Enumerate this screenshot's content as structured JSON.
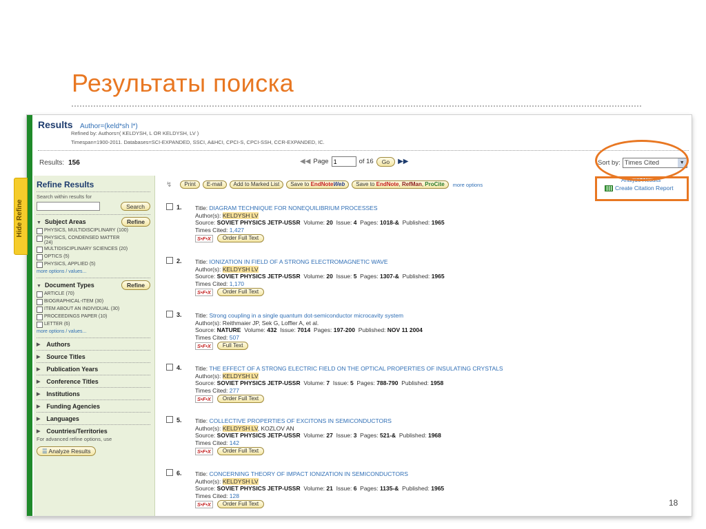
{
  "slide": {
    "title": "Результаты поиска",
    "page_number": "18"
  },
  "header": {
    "results_label": "Results",
    "query": "Author=(keld*sh l*)",
    "refined_by": "Refined by: Authors=( KELDYSH, L OR KELDYSH, LV )",
    "timespan": "Timespan=1900-2011. Databases=SCI-EXPANDED, SSCI, A&HCI, CPCI-S, CPCI-SSH, CCR-EXPANDED, IC."
  },
  "results": {
    "label": "Results:",
    "count": "156"
  },
  "pager": {
    "page_label": "Page",
    "page_value": "1",
    "of_label": "of 16",
    "go": "Go"
  },
  "sort": {
    "label": "Sort by:",
    "value": "Times Cited"
  },
  "side_links": {
    "analyze": "Analyze Results",
    "citation_report": "Create Citation Report"
  },
  "hide_refine": "Hide Refine",
  "toolbar": {
    "print": "Print",
    "email": "E-mail",
    "add_marked": "Add to Marked List",
    "save_to": "Save to",
    "endnote": "EndNote",
    "web": "Web",
    "save_to2": "Save to",
    "refman": "RefMan",
    "procite": "ProCite",
    "more_options": "more options"
  },
  "refine": {
    "title": "Refine Results",
    "search_label": "Search within results for",
    "search_button": "Search",
    "subject_areas": {
      "label": "Subject Areas",
      "button": "Refine",
      "items": [
        {
          "name": "PHYSICS, MULTIDISCIPLINARY",
          "count": "(100)"
        },
        {
          "name": "PHYSICS, CONDENSED MATTER",
          "count": "(24)"
        },
        {
          "name": "MULTIDISCIPLINARY SCIENCES",
          "count": "(20)"
        },
        {
          "name": "OPTICS",
          "count": "(5)"
        },
        {
          "name": "PHYSICS, APPLIED",
          "count": "(5)"
        }
      ],
      "more": "more options / values..."
    },
    "document_types": {
      "label": "Document Types",
      "button": "Refine",
      "items": [
        {
          "name": "ARTICLE",
          "count": "(70)"
        },
        {
          "name": "BIOGRAPHICAL-ITEM",
          "count": "(30)"
        },
        {
          "name": "ITEM ABOUT AN INDIVIDUAL",
          "count": "(30)"
        },
        {
          "name": "PROCEEDINGS PAPER",
          "count": "(10)"
        },
        {
          "name": "LETTER",
          "count": "(6)"
        }
      ],
      "more": "more options / values..."
    },
    "collapsed": [
      "Authors",
      "Source Titles",
      "Publication Years",
      "Conference Titles",
      "Institutions",
      "Funding Agencies",
      "Languages",
      "Countries/Territories"
    ],
    "advanced_note": "For advanced refine options, use",
    "analyze_button": "Analyze Results"
  },
  "records": [
    {
      "num": "1.",
      "title_label": "Title:",
      "title": "DIAGRAM TECHNIQUE FOR NONEQUILIBRIUM PROCESSES",
      "authors_label": "Author(s):",
      "authors_hl": "KELDYSH LV",
      "authors_rest": "",
      "source_label": "Source:",
      "source": "SOVIET PHYSICS JETP-USSR",
      "volume_label": "Volume:",
      "volume": "20",
      "issue_label": "Issue:",
      "issue": "4",
      "pages_label": "Pages:",
      "pages": "1018-&",
      "published_label": "Published:",
      "published": "1965",
      "cited_label": "Times Cited:",
      "cited": "1,427",
      "button": "Order Full Text"
    },
    {
      "num": "2.",
      "title_label": "Title:",
      "title": "IONIZATION IN FIELD OF A STRONG ELECTROMAGNETIC WAVE",
      "authors_label": "Author(s):",
      "authors_hl": "KELDYSH LV",
      "authors_rest": "",
      "source_label": "Source:",
      "source": "SOVIET PHYSICS JETP-USSR",
      "volume_label": "Volume:",
      "volume": "20",
      "issue_label": "Issue:",
      "issue": "5",
      "pages_label": "Pages:",
      "pages": "1307-&",
      "published_label": "Published:",
      "published": "1965",
      "cited_label": "Times Cited:",
      "cited": "1,170",
      "button": "Order Full Text"
    },
    {
      "num": "3.",
      "title_label": "Title:",
      "title": "Strong coupling in a single quantum dot-semiconductor microcavity system",
      "authors_label": "Author(s):",
      "authors_hl": "",
      "authors_rest": "Reithmaier JP, Sek G, Loffler A, et al.",
      "source_label": "Source:",
      "source": "NATURE",
      "volume_label": "Volume:",
      "volume": "432",
      "issue_label": "Issue:",
      "issue": "7014",
      "pages_label": "Pages:",
      "pages": "197-200",
      "published_label": "Published:",
      "published": "NOV 11 2004",
      "cited_label": "Times Cited:",
      "cited": "507",
      "button": "Full Text"
    },
    {
      "num": "4.",
      "title_label": "Title:",
      "title": "THE EFFECT OF A STRONG ELECTRIC FIELD ON THE OPTICAL PROPERTIES OF INSULATING CRYSTALS",
      "authors_label": "Author(s):",
      "authors_hl": "KELDYSH LV",
      "authors_rest": "",
      "source_label": "Source:",
      "source": "SOVIET PHYSICS JETP-USSR",
      "volume_label": "Volume:",
      "volume": "7",
      "issue_label": "Issue:",
      "issue": "5",
      "pages_label": "Pages:",
      "pages": "788-790",
      "published_label": "Published:",
      "published": "1958",
      "cited_label": "Times Cited:",
      "cited": "277",
      "button": "Order Full Text"
    },
    {
      "num": "5.",
      "title_label": "Title:",
      "title": "COLLECTIVE PROPERTIES OF EXCITONS IN SEMICONDUCTORS",
      "authors_label": "Author(s):",
      "authors_hl": "KELDYSH LV",
      "authors_rest": ", KOZLOV AN",
      "source_label": "Source:",
      "source": "SOVIET PHYSICS JETP-USSR",
      "volume_label": "Volume:",
      "volume": "27",
      "issue_label": "Issue:",
      "issue": "3",
      "pages_label": "Pages:",
      "pages": "521-&",
      "published_label": "Published:",
      "published": "1968",
      "cited_label": "Times Cited:",
      "cited": "142",
      "button": "Order Full Text"
    },
    {
      "num": "6.",
      "title_label": "Title:",
      "title": "CONCERNING THEORY OF IMPACT IONIZATION IN SEMICONDUCTORS",
      "authors_label": "Author(s):",
      "authors_hl": "KELDYSH LV",
      "authors_rest": "",
      "source_label": "Source:",
      "source": "SOVIET PHYSICS JETP-USSR",
      "volume_label": "Volume:",
      "volume": "21",
      "issue_label": "Issue:",
      "issue": "6",
      "pages_label": "Pages:",
      "pages": "1135-&",
      "published_label": "Published:",
      "published": "1965",
      "cited_label": "Times Cited:",
      "cited": "128",
      "button": "Order Full Text"
    }
  ],
  "sfx_label": "S•F•X",
  "colors": {
    "accent": "#e87722",
    "link": "#2f6eb5",
    "brand_green": "#1f8a2a",
    "highlight": "#f8e19a"
  }
}
